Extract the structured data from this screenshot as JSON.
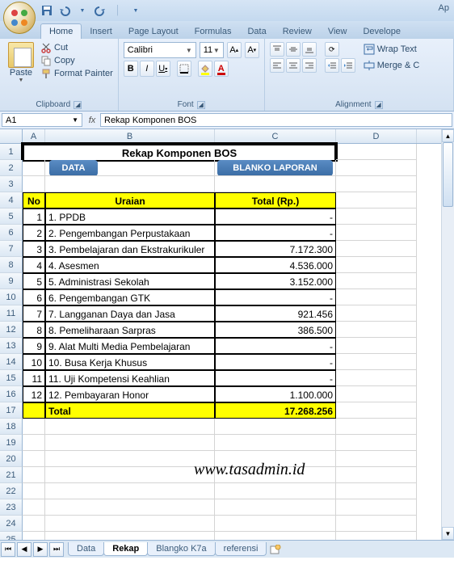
{
  "app": {
    "title_partial": "Ap"
  },
  "qat": {
    "save": "save-icon",
    "undo": "undo-icon",
    "redo": "redo-icon"
  },
  "tabs": [
    "Home",
    "Insert",
    "Page Layout",
    "Formulas",
    "Data",
    "Review",
    "View",
    "Develope"
  ],
  "active_tab": "Home",
  "clipboard": {
    "paste": "Paste",
    "cut": "Cut",
    "copy": "Copy",
    "format_painter": "Format Painter",
    "label": "Clipboard"
  },
  "font": {
    "name": "Calibri",
    "size": "11",
    "label": "Font"
  },
  "alignment": {
    "wrap": "Wrap Text",
    "merge": "Merge & C",
    "label": "Alignment"
  },
  "namebox": "A1",
  "formula": "Rekap Komponen BOS",
  "cols": [
    "A",
    "B",
    "C",
    "D"
  ],
  "sheet": {
    "title": "Rekap Komponen BOS",
    "btn_data": "DATA",
    "btn_blanko": "BLANKO LAPORAN",
    "headers": {
      "no": "No",
      "uraian": "Uraian",
      "total": "Total (Rp.)"
    },
    "rows": [
      {
        "no": "1",
        "uraian": "1. PPDB",
        "total": "-"
      },
      {
        "no": "2",
        "uraian": "2. Pengembangan Perpustakaan",
        "total": "-"
      },
      {
        "no": "3",
        "uraian": "3. Pembelajaran dan Ekstrakurikuler",
        "total": "7.172.300"
      },
      {
        "no": "4",
        "uraian": "4. Asesmen",
        "total": "4.536.000"
      },
      {
        "no": "5",
        "uraian": "5. Administrasi Sekolah",
        "total": "3.152.000"
      },
      {
        "no": "6",
        "uraian": "6. Pengembangan GTK",
        "total": "-"
      },
      {
        "no": "7",
        "uraian": "7. Langganan Daya dan Jasa",
        "total": "921.456"
      },
      {
        "no": "8",
        "uraian": "8. Pemeliharaan Sarpras",
        "total": "386.500"
      },
      {
        "no": "9",
        "uraian": "9. Alat Multi Media Pembelajaran",
        "total": "-"
      },
      {
        "no": "10",
        "uraian": "10. Busa Kerja Khusus",
        "total": "-"
      },
      {
        "no": "11",
        "uraian": "11. Uji Kompetensi Keahlian",
        "total": "-"
      },
      {
        "no": "12",
        "uraian": "12. Pembayaran Honor",
        "total": "1.100.000"
      }
    ],
    "total_label": "Total",
    "total_value": "17.268.256",
    "watermark": "www.tasadmin.id"
  },
  "sheet_tabs": [
    "Data",
    "Rekap",
    "Blangko K7a",
    "referensi"
  ],
  "active_sheet": "Rekap"
}
